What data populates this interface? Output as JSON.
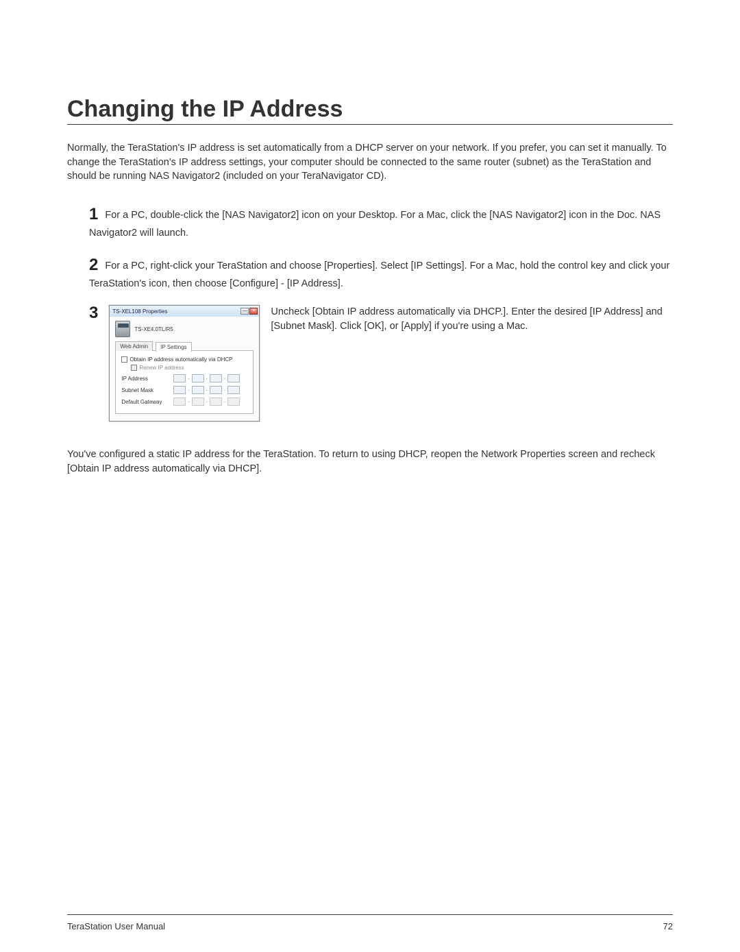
{
  "heading": "Changing the IP Address",
  "intro": "Normally, the TeraStation's IP address is set automatically from a DHCP server on your network.  If you prefer, you can set it manually.  To change the TeraStation's IP address settings, your computer should be connected to the same router (subnet) as the TeraStation and should be running NAS Navigator2 (included on your TeraNavigator CD).",
  "step1": "For a PC, double-click the [NAS Navigator2] icon on your Desktop.   For a Mac, click the [NAS Navigator2] icon in the Doc.  NAS Navigator2 will launch.",
  "step2": "For a PC, right-click your TeraStation and choose [Properties]. Select [IP Settings].  For a Mac, hold the control key and click your TeraStation's icon, then choose [Configure] - [IP Address].",
  "step3_text": "Uncheck [Obtain IP address automatically via DHCP.].  Enter the desired [IP Address] and [Subnet Mask].  Click [OK], or [Apply] if you're using a Mac.",
  "step_nums": {
    "s1": "1",
    "s2": "2",
    "s3": "3"
  },
  "dialog": {
    "title": "TS-XEL108 Properties",
    "device_name": "TS-XE4.0TL/R5",
    "tabs": {
      "web_admin": "Web Admin",
      "ip_settings": "IP Settings"
    },
    "chk_dhcp": "Obtain IP address automatically via DHCP",
    "chk_renew": "Renew IP address",
    "lbl_ip": "IP Address",
    "lbl_subnet": "Subnet Mask",
    "lbl_gateway": "Default Gateway"
  },
  "closing": "You've configured a static IP address for the TeraStation.  To return to using DHCP, reopen the Network Properties screen and recheck [Obtain IP address automatically via DHCP].",
  "footer_left": "TeraStation User Manual",
  "footer_right": "72"
}
